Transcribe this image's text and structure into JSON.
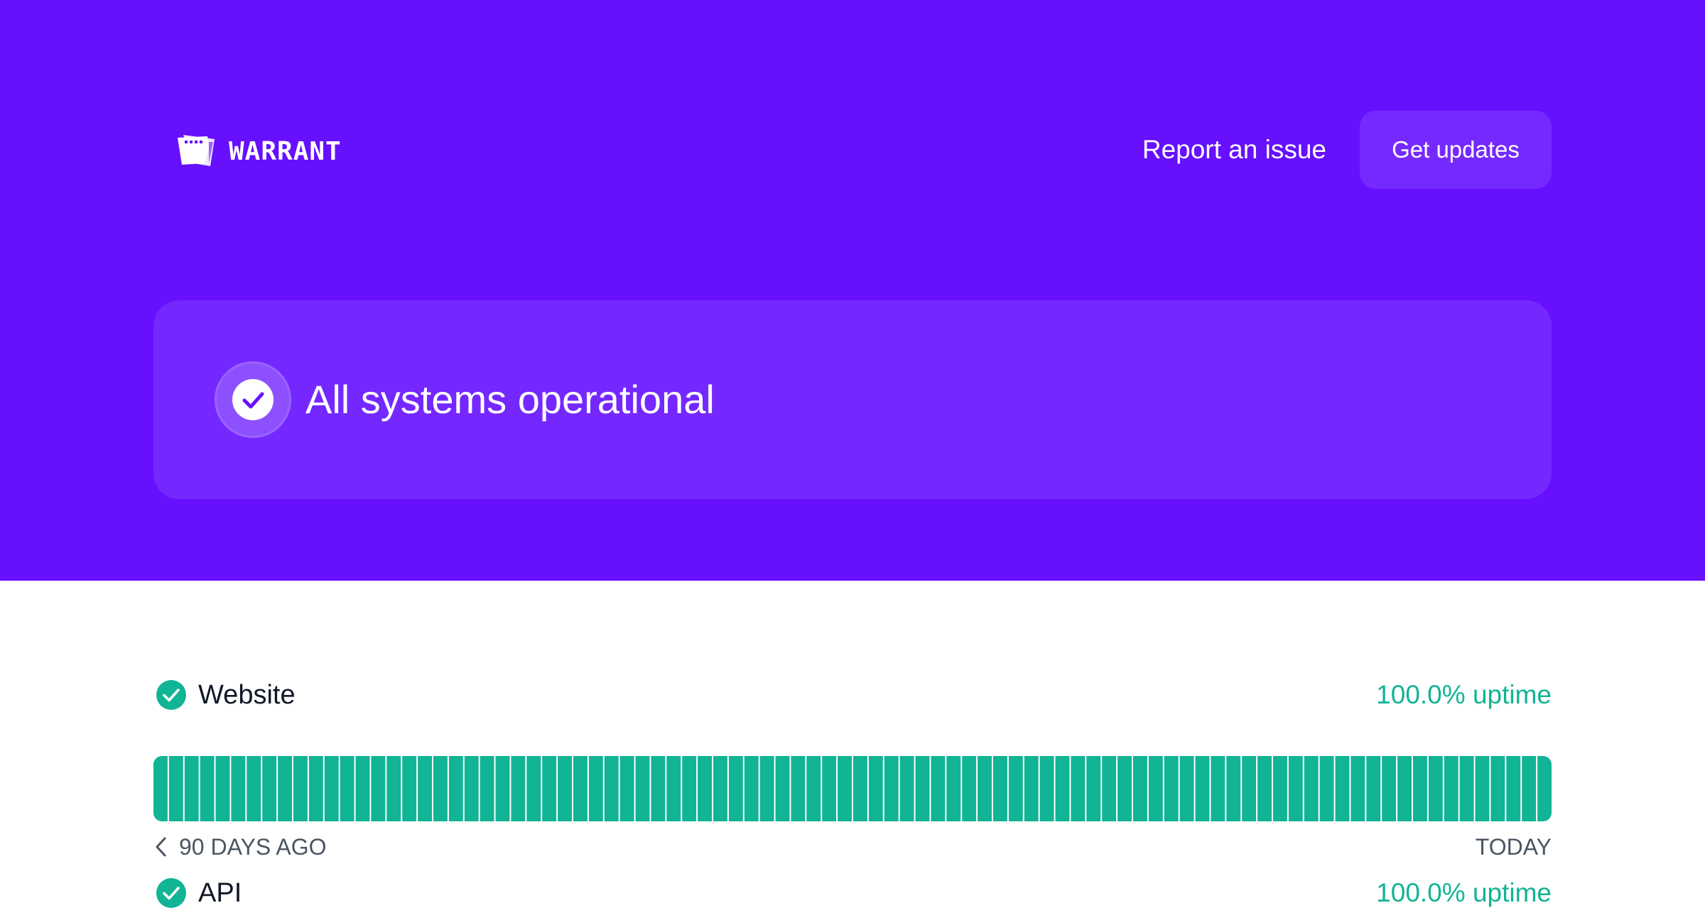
{
  "header": {
    "brand_name": "WARRANT",
    "logo_icon": "warrant-logo-icon",
    "report_label": "Report an issue",
    "updates_label": "Get updates"
  },
  "status": {
    "message": "All systems operational",
    "icon": "check-circle-icon"
  },
  "components": [
    {
      "name": "Website",
      "uptime_text": "100.0% uptime",
      "status": "operational",
      "days": 90,
      "range_start": "90 DAYS AGO",
      "range_end": "TODAY"
    },
    {
      "name": "API",
      "uptime_text": "100.0% uptime",
      "status": "operational"
    }
  ],
  "colors": {
    "hero_background": "#6610fe",
    "card_background": "#7428ff",
    "operational": "#11b494",
    "text_primary": "#111827",
    "text_muted": "#4b5563"
  }
}
